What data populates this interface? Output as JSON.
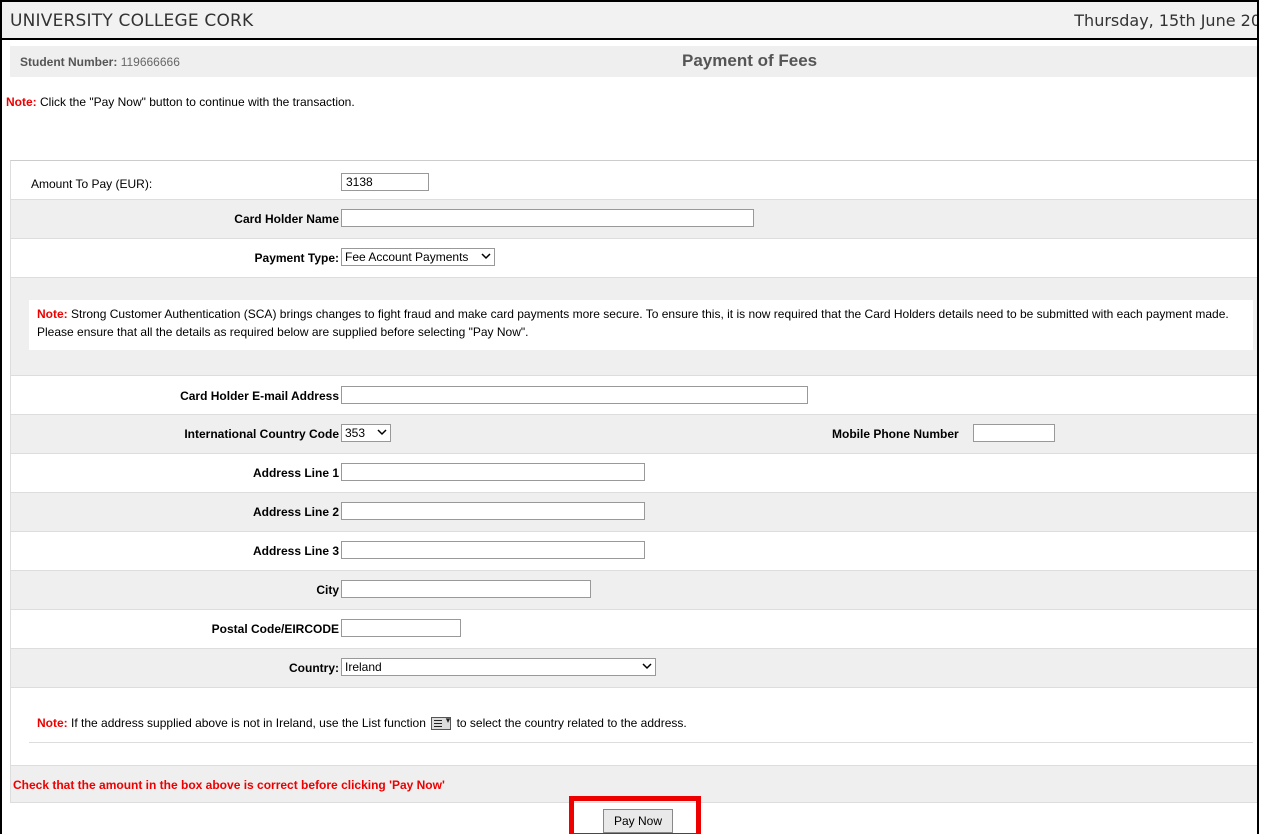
{
  "header": {
    "brand": "UNIVERSITY COLLEGE CORK",
    "date": "Thursday, 15th June 20"
  },
  "student": {
    "label": "Student Number:",
    "number": "119666666"
  },
  "page_title": "Payment of Fees",
  "top_note": {
    "prefix": "Note:",
    "text": " Click the \"Pay Now\" button to continue with the transaction."
  },
  "form": {
    "amount_label": "Amount To Pay (EUR):",
    "amount_value": "3138",
    "card_holder_label": "Card Holder Name",
    "card_holder_value": "",
    "payment_type_label": "Payment Type:",
    "payment_type_value": "Fee Account Payments",
    "sca_note_prefix": "Note:",
    "sca_note_text": " Strong Customer Authentication (SCA) brings changes to fight fraud and make card payments more secure. To ensure this, it is now required that the Card Holders details need to be submitted with each payment made. Please ensure that all the details as required below are supplied before selecting \"Pay Now\".",
    "email_label": "Card Holder E-mail Address",
    "country_code_label": "International Country Code",
    "country_code_value": "353",
    "mobile_label": "Mobile Phone Number",
    "address1_label": "Address Line 1",
    "address2_label": "Address Line 2",
    "address3_label": "Address Line 3",
    "city_label": "City",
    "postal_label": "Postal Code/EIRCODE",
    "country_label": "Country:",
    "country_value": "Ireland",
    "address_note_prefix": "Note:",
    "address_note_text_1": " If the address supplied above is not in Ireland, use the List function ",
    "address_note_text_2": " to select the country related to the address.",
    "check_text": "Check that the amount in the box above is correct before clicking 'Pay Now'"
  },
  "pay_button": "Pay Now",
  "colors": {
    "note_red": "#e00000",
    "highlight_box": "#e00000",
    "grey_row": "#efefef"
  }
}
